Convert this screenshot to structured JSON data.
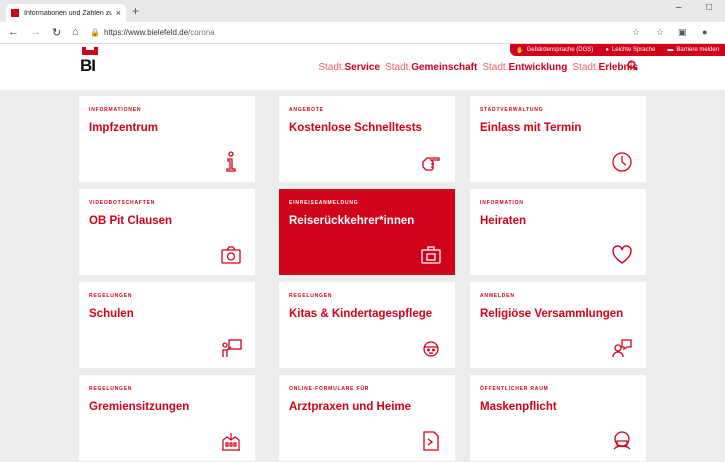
{
  "browser": {
    "tab_title": "Informationen und Zahlen zum",
    "tab_close": "×",
    "new_tab": "+",
    "url_host": "https://www.bielefeld.de",
    "url_path": "/corona",
    "minimize": "–",
    "maximize": "□"
  },
  "site": {
    "logo_text": "BI",
    "help": [
      {
        "label": "Gebärdensprache (DGS)",
        "icon": "hand-icon"
      },
      {
        "label": "Leichte Sprache",
        "icon": "easy-language-icon"
      },
      {
        "label": "Barriere melden",
        "icon": "message-icon"
      }
    ],
    "nav": [
      {
        "prefix": "Stadt.",
        "label": "Service"
      },
      {
        "prefix": "Stadt.",
        "label": "Gemeinschaft"
      },
      {
        "prefix": "Stadt.",
        "label": "Entwicklung"
      },
      {
        "prefix": "Stadt.",
        "label": "Erlebnis"
      }
    ]
  },
  "tiles": [
    {
      "category": "INFORMATIONEN",
      "title": "Impfzentrum",
      "icon": "info-icon"
    },
    {
      "category": "ANGEBOTE",
      "title": "Kostenlose Schnelltests",
      "icon": "pointing-hand-icon"
    },
    {
      "category": "STADTVERWALTUNG",
      "title": "Einlass mit Termin",
      "icon": "clock-icon"
    },
    {
      "category": "VIDEOBOTSCHAFTEN",
      "title": "OB Pit Clausen",
      "icon": "camera-icon"
    },
    {
      "category": "EINREISEANMELDUNG",
      "title": "Reiserückkehrer*innen",
      "icon": "suitcase-icon"
    },
    {
      "category": "INFORMATION",
      "title": "Heiraten",
      "icon": "heart-icon"
    },
    {
      "category": "REGELUNGEN",
      "title": "Schulen",
      "icon": "teacher-board-icon"
    },
    {
      "category": "REGELUNGEN",
      "title": "Kitas & Kindertagespflege",
      "icon": "child-face-icon"
    },
    {
      "category": "ANMELDEN",
      "title": "Religiöse Versammlungen",
      "icon": "speech-person-icon"
    },
    {
      "category": "REGELUNGEN",
      "title": "Gremiensitzungen",
      "icon": "townhall-icon"
    },
    {
      "category": "ONLINE-FORMULARE FÜR",
      "title": "Arztpraxen und Heime",
      "icon": "document-icon"
    },
    {
      "category": "ÖFFENTLICHER RAUM",
      "title": "Maskenpflicht",
      "icon": "mask-face-icon"
    }
  ]
}
